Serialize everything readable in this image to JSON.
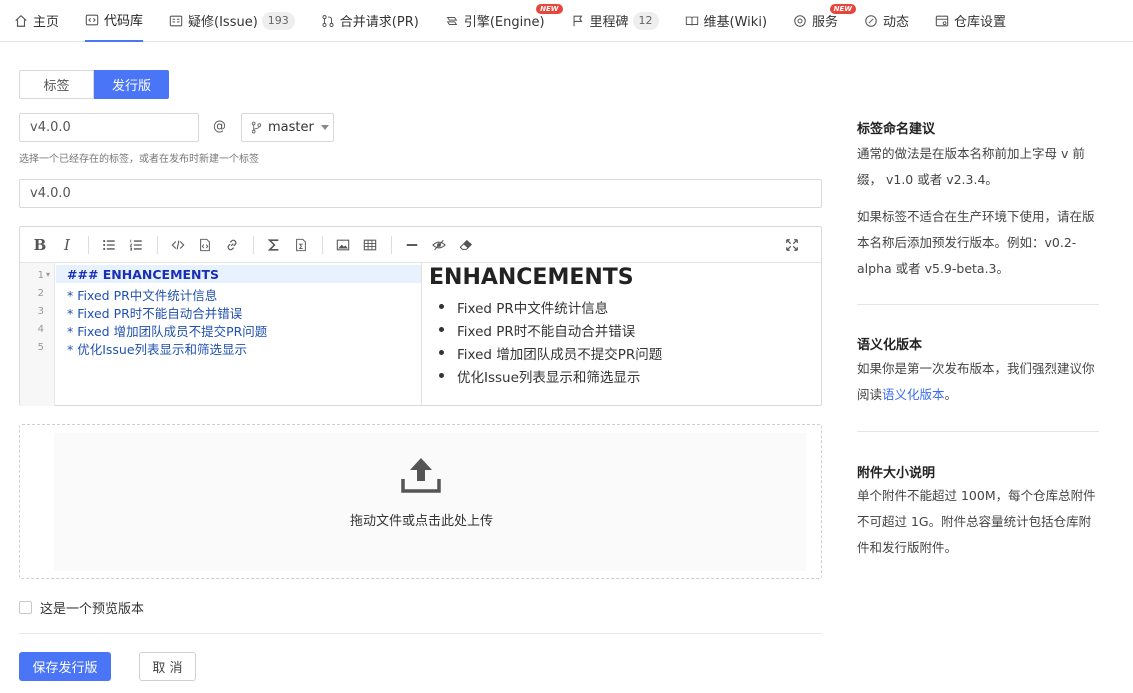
{
  "nav": {
    "items": [
      {
        "label": "主页",
        "icon": "home-icon"
      },
      {
        "label": "代码库",
        "icon": "code-icon",
        "active": true
      },
      {
        "label": "疑修(Issue)",
        "icon": "issue-icon",
        "badge": "193"
      },
      {
        "label": "合并请求(PR)",
        "icon": "pull-request-icon"
      },
      {
        "label": "引擎(Engine)",
        "icon": "engine-icon",
        "new": "NEW"
      },
      {
        "label": "里程碑",
        "icon": "flag-icon",
        "badge": "12"
      },
      {
        "label": "维基(Wiki)",
        "icon": "book-icon"
      },
      {
        "label": "服务",
        "icon": "service-icon",
        "new": "NEW"
      },
      {
        "label": "动态",
        "icon": "activity-icon"
      },
      {
        "label": "仓库设置",
        "icon": "settings-icon"
      }
    ]
  },
  "tabs": {
    "tag": "标签",
    "release": "发行版"
  },
  "form": {
    "tag_value": "v4.0.0",
    "at": "@",
    "branch": "master",
    "hint": "选择一个已经存在的标签，或者在发布时新建一个标签",
    "title_value": "v4.0.0"
  },
  "editor": {
    "lines": [
      "### ENHANCEMENTS",
      "  * Fixed PR中文件统计信息",
      "  * Fixed PR时不能自动合并错误",
      "  * Fixed 增加团队成员不提交PR问题",
      "  * 优化Issue列表显示和筛选显示"
    ],
    "line_numbers": [
      "1",
      "2",
      "3",
      "4",
      "5"
    ],
    "fold_marker": "▾",
    "preview_heading": "ENHANCEMENTS",
    "preview_items": [
      "Fixed PR中文件统计信息",
      "Fixed PR时不能自动合并错误",
      "Fixed 增加团队成员不提交PR问题",
      "优化Issue列表显示和筛选显示"
    ]
  },
  "upload": {
    "text": "拖动文件或点击此处上传"
  },
  "prerelease": {
    "label": "这是一个预览版本"
  },
  "actions": {
    "save": "保存发行版",
    "cancel": "取 消"
  },
  "sidebar": {
    "sections": [
      {
        "title": "标签命名建议",
        "text": "通常的做法是在版本名称前加上字母 v 前缀， v1.0 或者 v2.3.4。",
        "text2": "如果标签不适合在生产环境下使用，请在版本名称后添加预发行版本。例如：v0.2-alpha 或者 v5.9-beta.3。"
      },
      {
        "title": "语义化版本",
        "text_before": "如果你是第一次发布版本，我们强烈建议你阅读",
        "link": "语义化版本",
        "text_after": "。"
      },
      {
        "title": "附件大小说明",
        "text": "单个附件不能超过 100M，每个仓库总附件不可超过 1G。附件总容量统计包括仓库附件和发行版附件。"
      }
    ]
  },
  "colors": {
    "primary": "#4a75f6",
    "new_tag": "#e8453c"
  }
}
